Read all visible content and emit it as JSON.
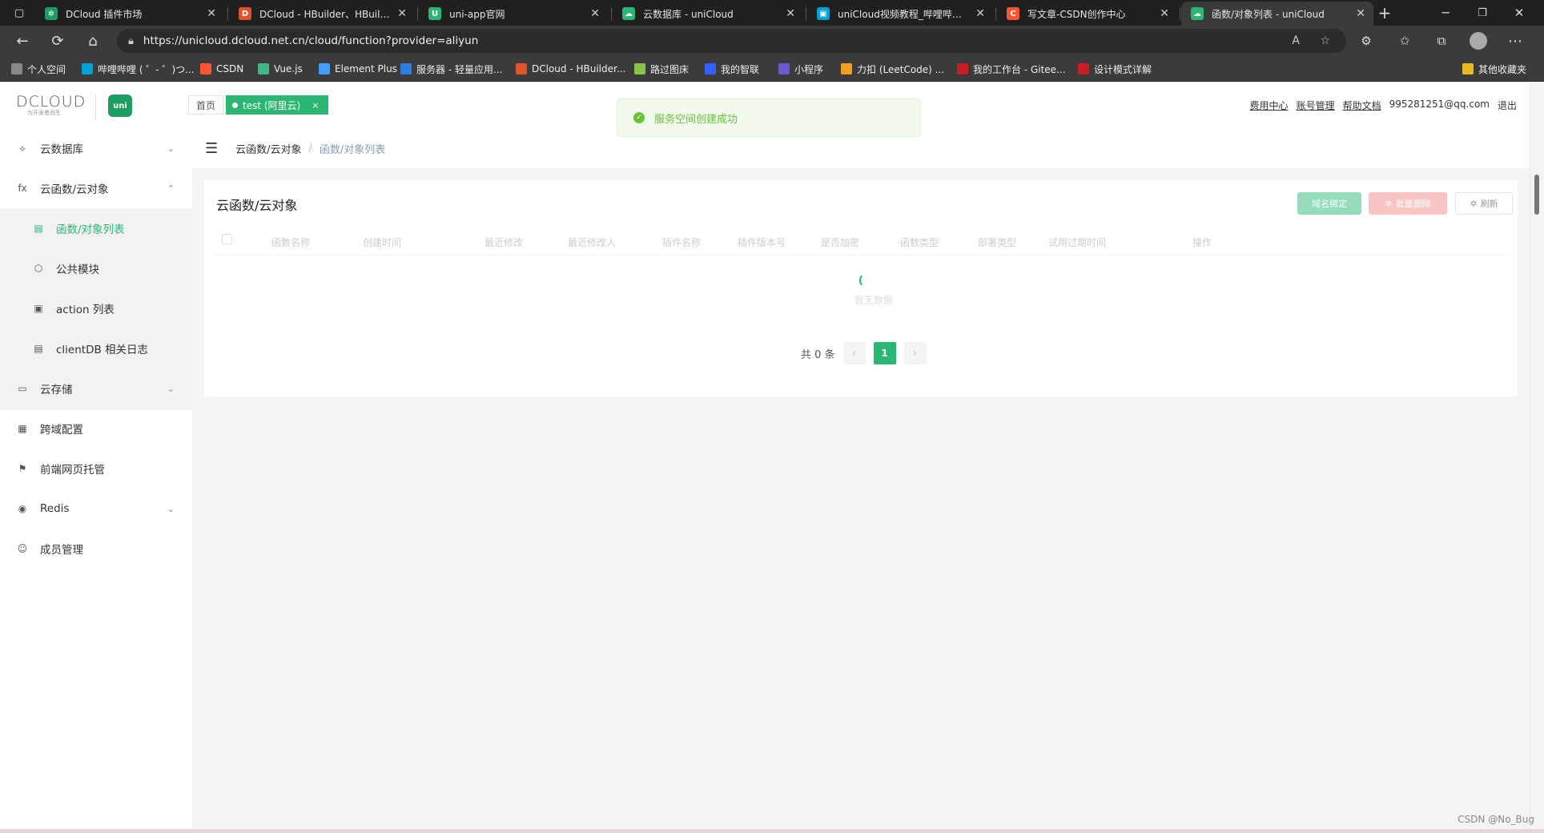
{
  "browser": {
    "tabs": [
      {
        "title": "DCloud 插件市场",
        "color": "#1d9d5f",
        "glyph": "✲"
      },
      {
        "title": "DCloud - HBuilder、HBuilderX...",
        "color": "#e0532b",
        "glyph": "D"
      },
      {
        "title": "uni-app官网",
        "color": "#2bb673",
        "glyph": "U"
      },
      {
        "title": "云数据库 - uniCloud",
        "color": "#2bb673",
        "glyph": "☁"
      },
      {
        "title": "uniCloud视频教程_哔哩哔哩_bilibili",
        "color": "#00a1d6",
        "glyph": "▣"
      },
      {
        "title": "写文章-CSDN创作中心",
        "color": "#fc5531",
        "glyph": "C"
      },
      {
        "title": "函数/对象列表 - uniCloud",
        "color": "#2bb673",
        "glyph": "☁"
      }
    ],
    "url": "https://unicloud.dcloud.net.cn/cloud/function?provider=aliyun",
    "bookmarks": [
      {
        "label": "个人空间",
        "color": "#888"
      },
      {
        "label": "哔哩哔哩 ( ゜- ゜)つ...",
        "color": "#00a1d6"
      },
      {
        "label": "CSDN",
        "color": "#fc5531"
      },
      {
        "label": "Vue.js",
        "color": "#41b883"
      },
      {
        "label": "Element Plus",
        "color": "#409eff"
      },
      {
        "label": "服务器 - 轻量应用...",
        "color": "#2f7de1"
      },
      {
        "label": "DCloud - HBuilder...",
        "color": "#e0532b"
      },
      {
        "label": "路过图床",
        "color": "#8bc34a"
      },
      {
        "label": "我的智联",
        "color": "#3361ff"
      },
      {
        "label": "小程序",
        "color": "#6a5acd"
      },
      {
        "label": "力扣 (LeetCode) ...",
        "color": "#f0a020"
      },
      {
        "label": "我的工作台 - Gitee...",
        "color": "#c71d23"
      },
      {
        "label": "设计模式详解",
        "color": "#c81d25"
      }
    ],
    "other_bookmarks": "其他收藏夹"
  },
  "header": {
    "logo_text": "DCLOUD",
    "logo_sub": "为开发者而生",
    "uni_badge": "uni",
    "tag_home": "首页",
    "tag_space": "test (阿里云)",
    "tag_close": "×",
    "links": [
      "费用中心",
      "账号管理",
      "帮助文档"
    ],
    "email": "995281251@qq.com",
    "logout": "退出"
  },
  "toast": {
    "message": "服务空间创建成功",
    "type": "success"
  },
  "sidebar": {
    "items": [
      {
        "label": "云数据库",
        "icon": "database-icon",
        "chev": "⌄"
      },
      {
        "label": "云函数/云对象",
        "icon": "function-icon",
        "chev": "⌃"
      },
      {
        "label": "函数/对象列表",
        "icon": "list-icon",
        "sub": true,
        "active": true
      },
      {
        "label": "公共模块",
        "icon": "cube-icon",
        "sub": true
      },
      {
        "label": "action 列表",
        "icon": "action-icon",
        "sub": true
      },
      {
        "label": "clientDB 相关日志",
        "icon": "log-icon",
        "sub": true
      },
      {
        "label": "云存储",
        "icon": "storage-icon",
        "chev": "⌄"
      },
      {
        "label": "跨域配置",
        "icon": "cors-icon"
      },
      {
        "label": "前端网页托管",
        "icon": "hosting-icon"
      },
      {
        "label": "Redis",
        "icon": "redis-icon",
        "chev": "⌄"
      },
      {
        "label": "成员管理",
        "icon": "members-icon"
      }
    ]
  },
  "breadcrumb": {
    "level1": "云函数/云对象",
    "sep": "/",
    "level2": "函数/对象列表"
  },
  "card": {
    "title": "云函数/云对象",
    "btn_domain": "域名绑定",
    "btn_batch_delete": "批量删除",
    "btn_refresh": "刷新",
    "columns": [
      "函数名称",
      "创建时间",
      "最近修改",
      "最近修改人",
      "插件名称",
      "插件版本号",
      "是否加密",
      "函数类型",
      "部署类型",
      "试用过期时间",
      "操作"
    ],
    "empty_text": "暂无数据"
  },
  "pagination": {
    "total_text": "共 0 条",
    "prev": "‹",
    "current": "1",
    "next": "›"
  },
  "watermark": "CSDN @No_Bug"
}
